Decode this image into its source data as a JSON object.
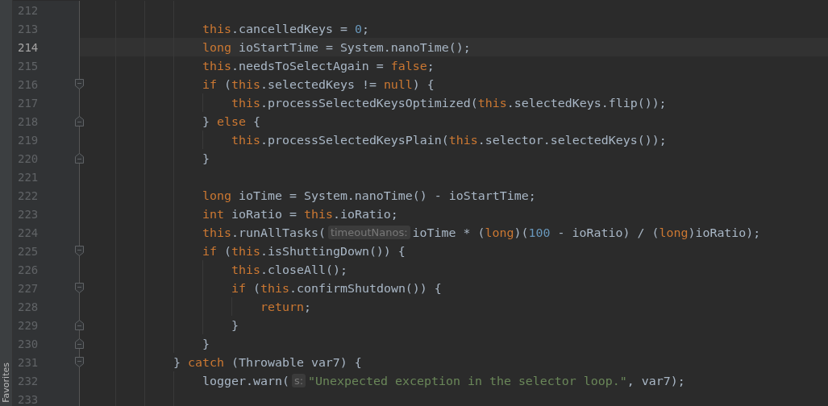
{
  "side_tab": {
    "label": "Favorites"
  },
  "lines": [
    {
      "children": [
        {
          "number": "212",
          "current": false,
          "fold_start": false,
          "fold_end": false
        },
        {
          "number": "213",
          "current": false,
          "fold_start": false,
          "fold_end": false,
          "tokens": [
            {
              "kind": "keyword",
              "text": "this"
            },
            {
              "kind": "plain",
              "text": ".cancelledKeys = "
            },
            {
              "kind": "number",
              "text": "0"
            },
            {
              "kind": "plain",
              "text": ";"
            }
          ]
        },
        {
          "number": "214",
          "current": true,
          "fold_start": false,
          "fold_end": false,
          "tokens": [
            {
              "kind": "keyword",
              "text": "long"
            },
            {
              "kind": "plain",
              "text": " ioStartTime = System.nanoTime();"
            }
          ]
        },
        {
          "number": "215",
          "current": false,
          "fold_start": false,
          "fold_end": false,
          "tokens": [
            {
              "kind": "keyword",
              "text": "this"
            },
            {
              "kind": "plain",
              "text": ".needsToSelectAgain = "
            },
            {
              "kind": "keyword",
              "text": "false"
            },
            {
              "kind": "plain",
              "text": ";"
            }
          ]
        },
        {
          "number": "216",
          "current": false,
          "fold_start": true,
          "fold_end": false,
          "tokens": [
            {
              "kind": "keyword",
              "text": "if"
            },
            {
              "kind": "plain",
              "text": " ("
            },
            {
              "kind": "keyword",
              "text": "this"
            },
            {
              "kind": "plain",
              "text": ".selectedKeys != "
            },
            {
              "kind": "keyword",
              "text": "null"
            },
            {
              "kind": "plain",
              "text": ") {"
            }
          ],
          "children": [
            {
              "number": "217",
              "current": false,
              "fold_start": false,
              "fold_end": false,
              "tokens": [
                {
                  "kind": "keyword",
                  "text": "this"
                },
                {
                  "kind": "plain",
                  "text": ".processSelectedKeysOptimized("
                },
                {
                  "kind": "keyword",
                  "text": "this"
                },
                {
                  "kind": "plain",
                  "text": ".selectedKeys.flip());"
                }
              ]
            }
          ]
        },
        {
          "number": "218",
          "current": false,
          "fold_start": false,
          "fold_end": true,
          "tokens": [
            {
              "kind": "plain",
              "text": "} "
            },
            {
              "kind": "keyword",
              "text": "else"
            },
            {
              "kind": "plain",
              "text": " {"
            }
          ],
          "children": [
            {
              "number": "219",
              "current": false,
              "fold_start": false,
              "fold_end": false,
              "tokens": [
                {
                  "kind": "keyword",
                  "text": "this"
                },
                {
                  "kind": "plain",
                  "text": ".processSelectedKeysPlain("
                },
                {
                  "kind": "keyword",
                  "text": "this"
                },
                {
                  "kind": "plain",
                  "text": ".selector.selectedKeys());"
                }
              ]
            }
          ]
        },
        {
          "number": "220",
          "current": false,
          "fold_start": false,
          "fold_end": true,
          "tokens": [
            {
              "kind": "plain",
              "text": "}"
            }
          ]
        },
        {
          "number": "221",
          "current": false,
          "fold_start": false,
          "fold_end": false
        },
        {
          "number": "222",
          "current": false,
          "fold_start": false,
          "fold_end": false,
          "tokens": [
            {
              "kind": "keyword",
              "text": "long"
            },
            {
              "kind": "plain",
              "text": " ioTime = System.nanoTime() - ioStartTime;"
            }
          ]
        },
        {
          "number": "223",
          "current": false,
          "fold_start": false,
          "fold_end": false,
          "tokens": [
            {
              "kind": "keyword",
              "text": "int"
            },
            {
              "kind": "plain",
              "text": " ioRatio = "
            },
            {
              "kind": "keyword",
              "text": "this"
            },
            {
              "kind": "plain",
              "text": ".ioRatio;"
            }
          ]
        },
        {
          "number": "224",
          "current": false,
          "fold_start": false,
          "fold_end": false,
          "tokens": [
            {
              "kind": "keyword",
              "text": "this"
            },
            {
              "kind": "plain",
              "text": ".runAllTasks("
            },
            {
              "kind": "hint",
              "text": "timeoutNanos:"
            },
            {
              "kind": "plain",
              "text": "ioTime * ("
            },
            {
              "kind": "keyword",
              "text": "long"
            },
            {
              "kind": "plain",
              "text": ")("
            },
            {
              "kind": "number",
              "text": "100"
            },
            {
              "kind": "plain",
              "text": " - ioRatio) / ("
            },
            {
              "kind": "keyword",
              "text": "long"
            },
            {
              "kind": "plain",
              "text": ")ioRatio);"
            }
          ]
        },
        {
          "number": "225",
          "current": false,
          "fold_start": true,
          "fold_end": false,
          "tokens": [
            {
              "kind": "keyword",
              "text": "if"
            },
            {
              "kind": "plain",
              "text": " ("
            },
            {
              "kind": "keyword",
              "text": "this"
            },
            {
              "kind": "plain",
              "text": ".isShuttingDown()) {"
            }
          ],
          "children": [
            {
              "number": "226",
              "current": false,
              "fold_start": false,
              "fold_end": false,
              "tokens": [
                {
                  "kind": "keyword",
                  "text": "this"
                },
                {
                  "kind": "plain",
                  "text": ".closeAll();"
                }
              ]
            },
            {
              "number": "227",
              "current": false,
              "fold_start": true,
              "fold_end": false,
              "tokens": [
                {
                  "kind": "keyword",
                  "text": "if"
                },
                {
                  "kind": "plain",
                  "text": " ("
                },
                {
                  "kind": "keyword",
                  "text": "this"
                },
                {
                  "kind": "plain",
                  "text": ".confirmShutdown()) {"
                }
              ],
              "children": [
                {
                  "number": "228",
                  "current": false,
                  "fold_start": false,
                  "fold_end": false,
                  "tokens": [
                    {
                      "kind": "keyword",
                      "text": "return"
                    },
                    {
                      "kind": "plain",
                      "text": ";"
                    }
                  ]
                }
              ]
            },
            {
              "number": "229",
              "current": false,
              "fold_start": false,
              "fold_end": true,
              "tokens": [
                {
                  "kind": "plain",
                  "text": "}"
                }
              ]
            }
          ]
        },
        {
          "number": "230",
          "current": false,
          "fold_start": false,
          "fold_end": true,
          "tokens": [
            {
              "kind": "plain",
              "text": "}"
            }
          ]
        }
      ]
    },
    {
      "number": "231",
      "current": false,
      "fold_start": true,
      "fold_end": false,
      "tokens": [
        {
          "kind": "plain",
          "text": "} "
        },
        {
          "kind": "keyword",
          "text": "catch"
        },
        {
          "kind": "plain",
          "text": " (Throwable var7) {"
        }
      ],
      "children": [
        {
          "number": "232",
          "current": false,
          "fold_start": false,
          "fold_end": false,
          "tokens": [
            {
              "kind": "plain",
              "text": "logger.warn("
            },
            {
              "kind": "hint",
              "text": "s:"
            },
            {
              "kind": "string",
              "text": "\"Unexpected exception in the selector loop.\""
            },
            {
              "kind": "plain",
              "text": ", var7);"
            }
          ]
        },
        {
          "number": "233",
          "current": false,
          "fold_start": false,
          "fold_end": false
        }
      ]
    }
  ]
}
